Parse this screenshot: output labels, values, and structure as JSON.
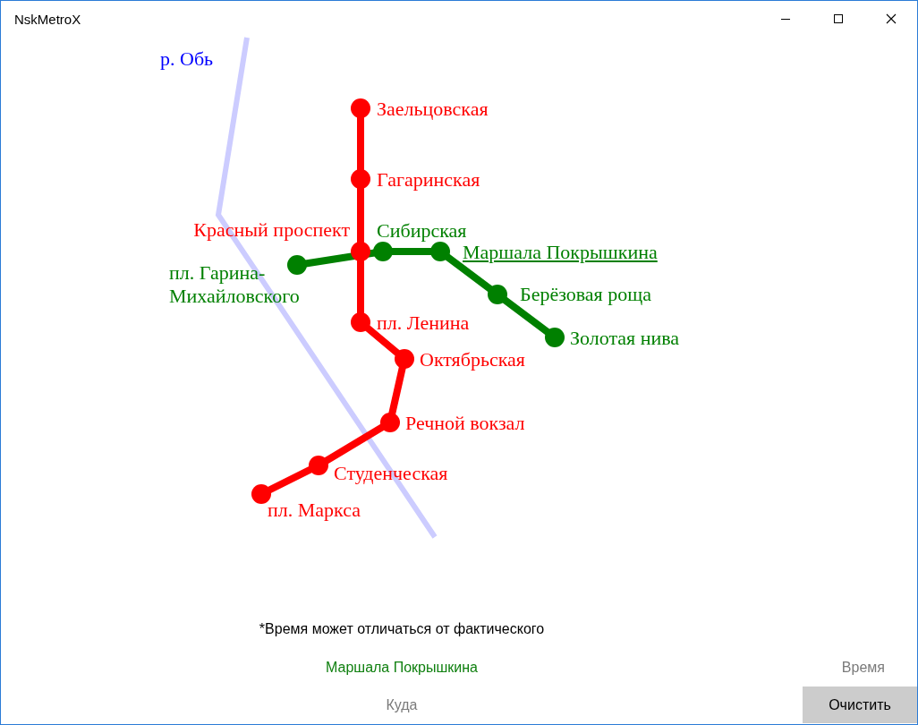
{
  "window": {
    "title": "NskMetroX"
  },
  "map": {
    "river": {
      "name": "р. Обь"
    },
    "lines": [
      {
        "color": "#ff0000",
        "stations": [
          {
            "name": "Заельцовская",
            "selected": false
          },
          {
            "name": "Гагаринская",
            "selected": false
          },
          {
            "name": "Красный проспект",
            "selected": false
          },
          {
            "name": "пл. Ленина",
            "selected": false
          },
          {
            "name": "Октябрьская",
            "selected": false
          },
          {
            "name": "Речной вокзал",
            "selected": false
          },
          {
            "name": "Студенческая",
            "selected": false
          },
          {
            "name": "пл. Маркса",
            "selected": false
          }
        ]
      },
      {
        "color": "#008000",
        "stations": [
          {
            "name": "пл. Гарина-Михайловского",
            "selected": false
          },
          {
            "name": "Сибирская",
            "selected": false
          },
          {
            "name": "Маршала Покрышкина",
            "selected": true
          },
          {
            "name": "Берёзовая роща",
            "selected": false
          },
          {
            "name": "Золотая нива",
            "selected": false
          }
        ]
      }
    ]
  },
  "note": "*Время может отличаться от фактического",
  "from": {
    "value": "Маршала Покрышкина"
  },
  "time": {
    "text": "Время"
  },
  "to": {
    "placeholder": "Куда"
  },
  "buttons": [
    {
      "label": "Очистить"
    }
  ]
}
